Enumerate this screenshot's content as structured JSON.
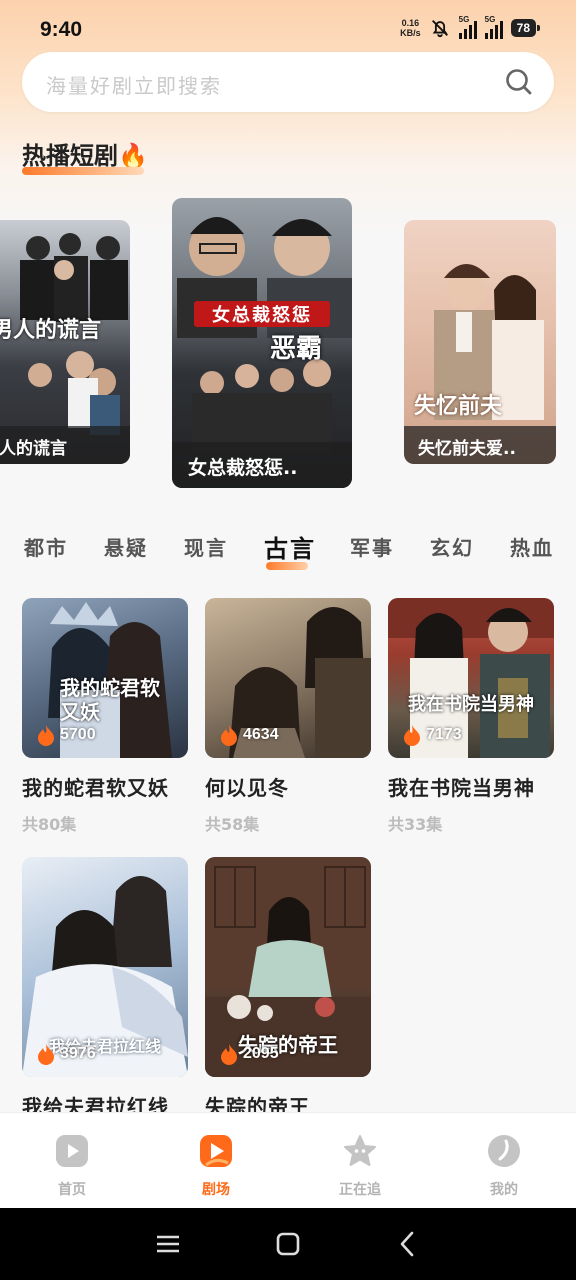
{
  "status_bar": {
    "time": "9:40",
    "net_speed_value": "0.16",
    "net_speed_unit": "KB/s",
    "signal_1_label": "5G",
    "signal_2_label": "5G",
    "battery": "78"
  },
  "search": {
    "placeholder": "海量好剧立即搜索",
    "icon": "search-icon"
  },
  "hot_section": {
    "title": "热播短剧",
    "emoji": "🔥",
    "cards": [
      {
        "title": "男人的谎言",
        "poster_text": "男人的谎言"
      },
      {
        "title": "女总裁怒惩..",
        "poster_text": "女总裁怒惩",
        "poster_sub": "恶霸"
      },
      {
        "title": "失忆前夫爱..",
        "poster_text": "失忆前夫"
      }
    ]
  },
  "categories": {
    "items": [
      "都市",
      "悬疑",
      "现言",
      "古言",
      "军事",
      "玄幻",
      "热血"
    ],
    "active": "古言"
  },
  "dramas": [
    {
      "title": "我的蛇君软又妖",
      "episodes": "共80集",
      "heat": "5700",
      "poster_text": "我的蛇君软又妖",
      "colors": [
        "#5b6e86",
        "#9fb3c9",
        "#2a3342"
      ]
    },
    {
      "title": "何以见冬",
      "episodes": "共58集",
      "heat": "4634",
      "poster_text": "",
      "colors": [
        "#8b7a66",
        "#c9b59a",
        "#3a2f27"
      ]
    },
    {
      "title": "我在书院当男神",
      "episodes": "共33集",
      "heat": "7173",
      "poster_text": "我在书院当男神",
      "colors": [
        "#9a3c2e",
        "#e8e3dc",
        "#3c3a33"
      ]
    },
    {
      "title": "我给夫君拉红线",
      "episodes": "",
      "heat": "3976",
      "poster_text": "我给夫君拉红线",
      "colors": [
        "#a9bfd8",
        "#e9eef5",
        "#6b7f98"
      ]
    },
    {
      "title": "失踪的帝王",
      "episodes": "",
      "heat": "2095",
      "poster_text": "失踪的帝王",
      "colors": [
        "#6b4a3a",
        "#b7d3c8",
        "#2c221c"
      ]
    }
  ],
  "bottom_nav": [
    {
      "label": "首页",
      "icon": "play-icon",
      "active": false
    },
    {
      "label": "剧场",
      "icon": "theater-icon",
      "active": true
    },
    {
      "label": "正在追",
      "icon": "star-icon",
      "active": false
    },
    {
      "label": "我的",
      "icon": "profile-leaf-icon",
      "active": false
    }
  ],
  "colors": {
    "accent": "#ff6a1a",
    "nav_inactive": "#b3b3b3",
    "top_gradient": "#fcd2ad"
  }
}
